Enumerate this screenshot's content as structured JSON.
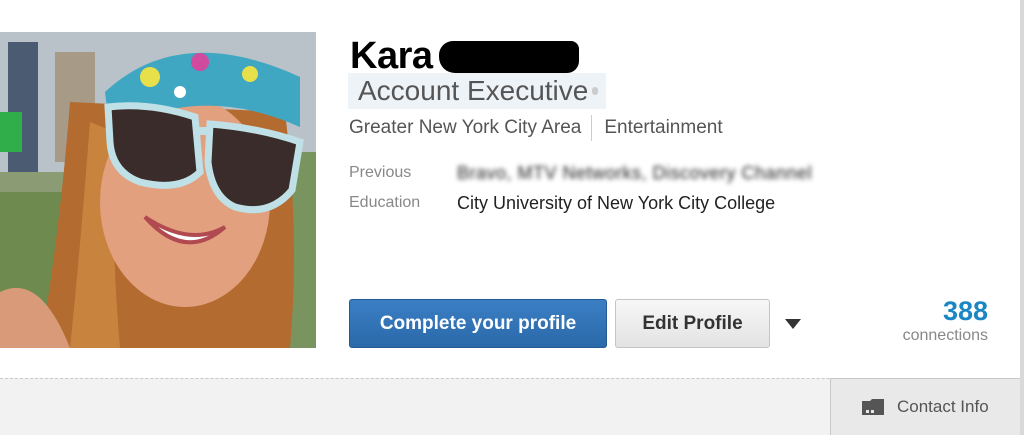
{
  "profile": {
    "name": "Kara",
    "headline": "Account Executive",
    "location": "Greater New York City Area",
    "industry": "Entertainment"
  },
  "details": {
    "previous_label": "Previous",
    "previous_value": "Bravo, MTV Networks, Discovery Channel",
    "education_label": "Education",
    "education_value": "City University of New York City College"
  },
  "actions": {
    "complete_profile_label": "Complete your profile",
    "edit_profile_label": "Edit Profile",
    "more_icon": "caret-down-icon"
  },
  "connections": {
    "count": "388",
    "label": "connections"
  },
  "contact": {
    "label": "Contact Info",
    "icon": "address-book-icon"
  },
  "colors": {
    "primary_button": "#2a69a9",
    "connections_count": "#1b86c4",
    "headline_highlight": "#eef3f8"
  }
}
